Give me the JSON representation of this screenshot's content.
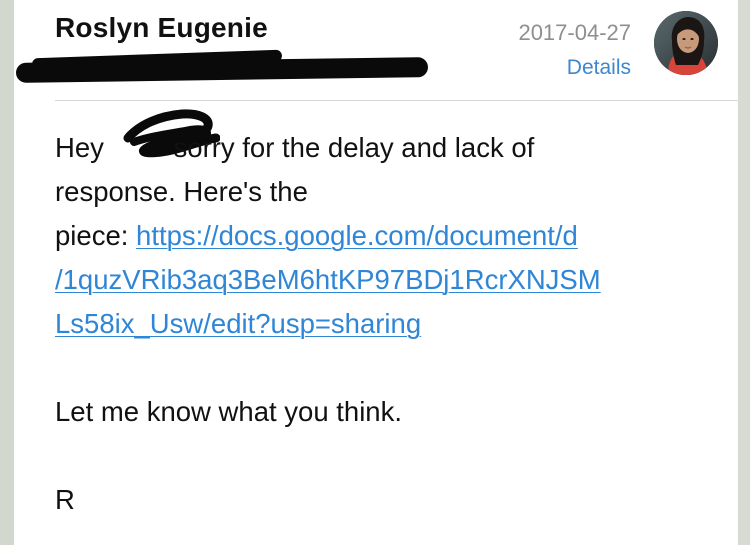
{
  "header": {
    "sender_name": "Roslyn Eugenie",
    "date": "2017-04-27",
    "details_label": "Details"
  },
  "avatar": {
    "icon": "profile-photo"
  },
  "message": {
    "line1_greeting": "Hey",
    "line1_rest": "sorry for the delay and lack of",
    "line2": "response. Here's the",
    "line3_prefix": "piece: ",
    "link_part1": "https://docs.google.com/document/d",
    "link_part2": "/1quzVRib3aq3BeM6htKP97BDj1RcrXNJSM",
    "link_part3": "Ls58ix_Usw/edit?usp=sharing",
    "closing": "Let me know what you think.",
    "signature": "R"
  },
  "colors": {
    "link": "#2f86d6",
    "details": "#3d86d0",
    "date": "#8e8e93",
    "redaction": "#0a0a0a"
  }
}
